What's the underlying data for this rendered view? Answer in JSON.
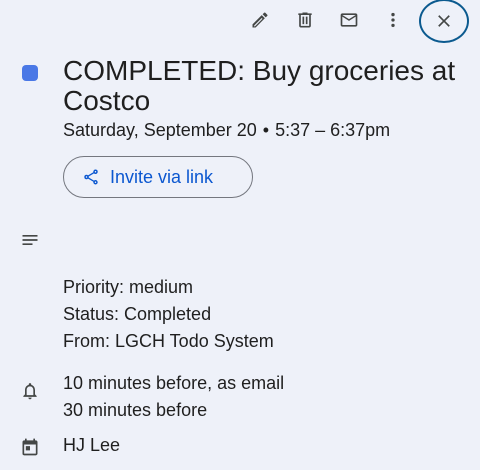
{
  "toolbar": {
    "edit_icon": "pencil-icon",
    "delete_icon": "trash-icon",
    "email_icon": "mail-icon",
    "more_icon": "more-vert-icon",
    "close_icon": "close-icon"
  },
  "event": {
    "color": "#4a78e6",
    "title": "COMPLETED: Buy groceries at Costco",
    "date": "Saturday, September 20",
    "separator": "•",
    "time": "5:37 – 6:37pm",
    "invite_label": "Invite via link"
  },
  "description": {
    "lines": [
      "Priority: medium",
      "Status: Completed",
      "From: LGCH Todo System"
    ]
  },
  "notifications": {
    "lines": [
      "10 minutes before, as email",
      "30 minutes before"
    ]
  },
  "calendar": {
    "owner": "HJ Lee"
  }
}
